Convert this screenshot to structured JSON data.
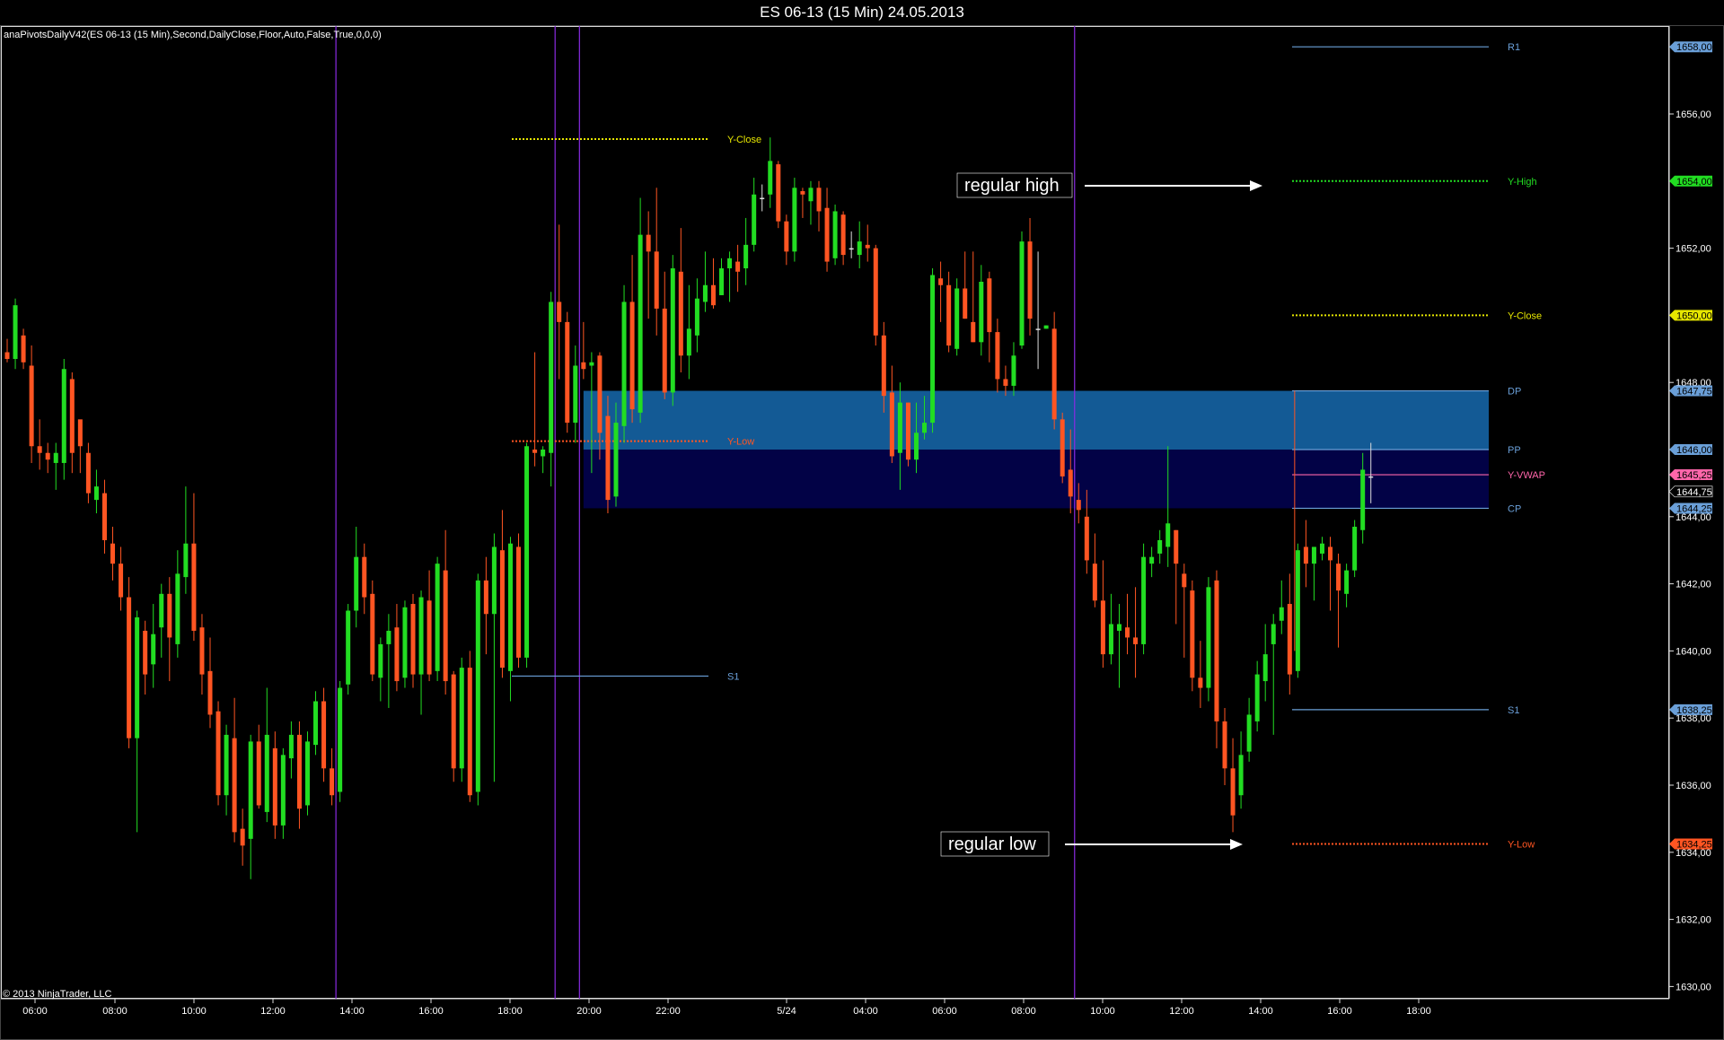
{
  "window": {
    "title": "ES 06-13 (15 Min)  24.05.2013",
    "indicator_label": "anaPivotsDailyV42(ES 06-13 (15 Min),Second,DailyClose,Floor,Auto,False,True,0,0,0)",
    "copyright": "© 2013 NinjaTrader, LLC"
  },
  "colors": {
    "background": "#000000",
    "up_candle": "#22dd22",
    "down_candle": "#ff5522",
    "neutral_candle": "#dddddd",
    "session_divider": "#8a2be2",
    "pivot_blue": "#6a9fd8",
    "y_close": "#e6e600",
    "y_high": "#22dd22",
    "y_low": "#ff5522",
    "y_vwap": "#ff66aa",
    "zone_upper": "#135a95",
    "zone_lower": "#020246"
  },
  "chart_data": {
    "type": "candlestick",
    "instrument": "ES 06-13",
    "interval": "15 Min",
    "ylim": [
      1629.5,
      1659.5
    ],
    "y_ticks": [
      "1656,00",
      "1654,00",
      "1652,00",
      "1650,00",
      "1648,00",
      "1646,00",
      "1644,00",
      "1642,00",
      "1640,00",
      "1638,00",
      "1636,00",
      "1634,00",
      "1632,00",
      "1630,00"
    ],
    "x_ticks": [
      "06:00",
      "08:00",
      "10:00",
      "12:00",
      "14:00",
      "16:00",
      "18:00",
      "20:00",
      "22:00",
      "5/24",
      "04:00",
      "06:00",
      "08:00",
      "10:00",
      "12:00",
      "14:00",
      "16:00",
      "18:00"
    ],
    "price_tags": [
      {
        "text": "1658,00",
        "value": 1658.0,
        "color": "#6a9fd8"
      },
      {
        "text": "1654,00",
        "value": 1654.0,
        "color": "#22dd22"
      },
      {
        "text": "1650,00",
        "value": 1650.0,
        "color": "#e6e600"
      },
      {
        "text": "1647,75",
        "value": 1647.75,
        "color": "#6a9fd8"
      },
      {
        "text": "1646,00",
        "value": 1646.0,
        "color": "#6a9fd8"
      },
      {
        "text": "1645,25",
        "value": 1645.25,
        "color": "#ff66aa"
      },
      {
        "text": "1644,75",
        "value": 1644.75,
        "color": "#000000"
      },
      {
        "text": "1644,25",
        "value": 1644.25,
        "color": "#6a9fd8"
      },
      {
        "text": "1638,25",
        "value": 1638.25,
        "color": "#6a9fd8"
      },
      {
        "text": "1634,25",
        "value": 1634.25,
        "color": "#ff5522"
      }
    ],
    "levels": [
      {
        "name": "Y-Close",
        "value": 1655.25,
        "from": "18:00",
        "to": "23:00",
        "style": "dotted",
        "color": "#e6e600"
      },
      {
        "name": "Y-Low",
        "value": 1646.25,
        "from": "18:00",
        "to": "23:00",
        "style": "dotted",
        "color": "#ff5522"
      },
      {
        "name": "S1",
        "value": 1639.25,
        "from": "18:00",
        "to": "23:00",
        "style": "solid",
        "color": "#6a9fd8"
      },
      {
        "name": "R1",
        "value": 1658.0,
        "from": "14:30",
        "to": "19:00",
        "style": "solid",
        "color": "#6a9fd8"
      },
      {
        "name": "Y-High",
        "value": 1654.0,
        "from": "14:30",
        "to": "19:00",
        "style": "dotted",
        "color": "#22dd22"
      },
      {
        "name": "Y-Close",
        "value": 1650.0,
        "from": "14:30",
        "to": "19:00",
        "style": "dotted",
        "color": "#e6e600"
      },
      {
        "name": "DP",
        "value": 1647.75,
        "from": "14:30",
        "to": "19:00",
        "style": "solid",
        "color": "#6a9fd8"
      },
      {
        "name": "PP",
        "value": 1646.0,
        "from": "14:30",
        "to": "19:00",
        "style": "solid",
        "color": "#6a9fd8"
      },
      {
        "name": "Y-VWAP",
        "value": 1645.25,
        "from": "14:30",
        "to": "19:00",
        "style": "solid",
        "color": "#ff66aa"
      },
      {
        "name": "CP",
        "value": 1644.25,
        "from": "14:30",
        "to": "19:00",
        "style": "solid",
        "color": "#6a9fd8"
      },
      {
        "name": "S1",
        "value": 1638.25,
        "from": "14:30",
        "to": "19:00",
        "style": "solid",
        "color": "#6a9fd8"
      },
      {
        "name": "Y-Low",
        "value": 1634.25,
        "from": "14:30",
        "to": "19:00",
        "style": "dotted",
        "color": "#ff5522"
      }
    ],
    "zones": [
      {
        "top": 1647.75,
        "bottom": 1646.0,
        "color": "#135a95"
      },
      {
        "top": 1646.0,
        "bottom": 1644.25,
        "color": "#020246"
      }
    ],
    "annotations": [
      {
        "text": "regular high",
        "arrow_to_value": 1654.0
      },
      {
        "text": "regular low",
        "arrow_to_value": 1634.25
      }
    ],
    "candles": [
      [
        1648.9,
        1649.3,
        1648.6,
        1648.7
      ],
      [
        1648.7,
        1650.5,
        1648.4,
        1650.3
      ],
      [
        1649.4,
        1649.6,
        1648.4,
        1648.6
      ],
      [
        1648.5,
        1649.1,
        1645.6,
        1646.1
      ],
      [
        1646.1,
        1646.9,
        1645.4,
        1645.9
      ],
      [
        1645.9,
        1646.2,
        1645.3,
        1645.7
      ],
      [
        1645.6,
        1646.2,
        1644.8,
        1645.9
      ],
      [
        1645.6,
        1648.7,
        1645.1,
        1648.4
      ],
      [
        1648.1,
        1648.3,
        1645.3,
        1645.9
      ],
      [
        1646.9,
        1646.4,
        1645.3,
        1646.1
      ],
      [
        1645.9,
        1646.2,
        1644.4,
        1644.7
      ],
      [
        1644.5,
        1645.4,
        1644.1,
        1644.9
      ],
      [
        1644.7,
        1645.1,
        1642.9,
        1643.3
      ],
      [
        1643.2,
        1643.7,
        1642.1,
        1642.6
      ],
      [
        1642.6,
        1643.1,
        1641.2,
        1641.6
      ],
      [
        1641.6,
        1642.2,
        1637.1,
        1637.4
      ],
      [
        1637.4,
        1641.2,
        1634.6,
        1641.0
      ],
      [
        1640.6,
        1640.9,
        1638.7,
        1639.3
      ],
      [
        1639.6,
        1641.4,
        1638.9,
        1640.5
      ],
      [
        1640.7,
        1642.0,
        1639.8,
        1641.7
      ],
      [
        1641.7,
        1642.2,
        1639.1,
        1640.4
      ],
      [
        1640.2,
        1643.0,
        1639.8,
        1642.3
      ],
      [
        1642.2,
        1644.9,
        1641.7,
        1643.2
      ],
      [
        1643.2,
        1644.7,
        1640.3,
        1640.6
      ],
      [
        1640.7,
        1641.1,
        1638.7,
        1639.3
      ],
      [
        1639.4,
        1640.4,
        1637.7,
        1638.1
      ],
      [
        1638.2,
        1638.5,
        1635.4,
        1635.7
      ],
      [
        1635.7,
        1637.8,
        1635.1,
        1637.5
      ],
      [
        1637.4,
        1638.6,
        1634.3,
        1634.6
      ],
      [
        1634.7,
        1635.3,
        1633.6,
        1634.2
      ],
      [
        1634.4,
        1637.5,
        1633.2,
        1637.3
      ],
      [
        1637.3,
        1637.8,
        1635.3,
        1635.4
      ],
      [
        1635.2,
        1638.9,
        1634.9,
        1637.5
      ],
      [
        1637.1,
        1637.6,
        1634.4,
        1634.8
      ],
      [
        1634.8,
        1637.1,
        1634.4,
        1636.9
      ],
      [
        1636.8,
        1637.9,
        1636.2,
        1637.5
      ],
      [
        1637.5,
        1637.9,
        1634.7,
        1635.3
      ],
      [
        1635.4,
        1637.6,
        1635.1,
        1637.3
      ],
      [
        1637.2,
        1638.8,
        1636.9,
        1638.5
      ],
      [
        1638.5,
        1638.9,
        1636.1,
        1636.5
      ],
      [
        1636.5,
        1637.1,
        1635.4,
        1635.7
      ],
      [
        1635.8,
        1639.1,
        1635.5,
        1638.9
      ],
      [
        1639.0,
        1641.4,
        1638.7,
        1641.2
      ],
      [
        1641.2,
        1643.7,
        1640.7,
        1642.8
      ],
      [
        1642.8,
        1643.2,
        1641.1,
        1641.6
      ],
      [
        1641.7,
        1642.1,
        1639.1,
        1639.3
      ],
      [
        1639.2,
        1640.4,
        1638.5,
        1640.2
      ],
      [
        1640.2,
        1641.1,
        1638.3,
        1640.6
      ],
      [
        1640.7,
        1641.4,
        1638.8,
        1639.1
      ],
      [
        1639.2,
        1641.5,
        1638.9,
        1641.3
      ],
      [
        1641.4,
        1641.7,
        1638.9,
        1639.3
      ],
      [
        1639.3,
        1641.8,
        1638.1,
        1641.6
      ],
      [
        1641.5,
        1642.4,
        1639.1,
        1639.3
      ],
      [
        1639.4,
        1642.8,
        1639.1,
        1642.6
      ],
      [
        1642.4,
        1643.6,
        1638.7,
        1639.1
      ],
      [
        1639.3,
        1639.4,
        1636.1,
        1636.5
      ],
      [
        1636.5,
        1639.8,
        1636.1,
        1639.5
      ],
      [
        1639.5,
        1640.0,
        1635.5,
        1635.7
      ],
      [
        1635.8,
        1642.3,
        1635.4,
        1642.1
      ],
      [
        1642.1,
        1642.8,
        1639.9,
        1641.1
      ],
      [
        1641.1,
        1643.5,
        1636.1,
        1643.1
      ],
      [
        1643.0,
        1644.2,
        1639.2,
        1639.5
      ],
      [
        1639.4,
        1643.4,
        1638.5,
        1643.2
      ],
      [
        1643.1,
        1643.5,
        1639.5,
        1639.8
      ],
      [
        1639.8,
        1646.2,
        1639.5,
        1646.1
      ],
      [
        1646.0,
        1648.9,
        1645.5,
        1645.9
      ],
      [
        1645.8,
        1646.1,
        1645.3,
        1646.0
      ],
      [
        1645.9,
        1650.7,
        1644.9,
        1650.4
      ],
      [
        1650.4,
        1652.7,
        1648.1,
        1649.8
      ],
      [
        1649.8,
        1650.1,
        1646.5,
        1646.8
      ],
      [
        1646.8,
        1649.1,
        1646.2,
        1648.5
      ],
      [
        1648.6,
        1649.8,
        1648.1,
        1648.4
      ],
      [
        1648.5,
        1648.9,
        1645.3,
        1648.6
      ],
      [
        1648.8,
        1648.9,
        1645.7,
        1646.5
      ],
      [
        1647.0,
        1647.6,
        1644.1,
        1644.5
      ],
      [
        1644.6,
        1647.4,
        1644.3,
        1646.8
      ],
      [
        1646.7,
        1650.9,
        1646.2,
        1650.4
      ],
      [
        1650.4,
        1651.8,
        1646.8,
        1647.2
      ],
      [
        1647.1,
        1653.5,
        1646.8,
        1652.4
      ],
      [
        1652.4,
        1653.1,
        1649.9,
        1651.9
      ],
      [
        1651.9,
        1653.8,
        1649.4,
        1650.2
      ],
      [
        1650.2,
        1651.3,
        1647.5,
        1647.7
      ],
      [
        1647.7,
        1651.8,
        1647.3,
        1651.4
      ],
      [
        1651.3,
        1652.6,
        1648.3,
        1648.8
      ],
      [
        1648.8,
        1650.9,
        1648.1,
        1649.6
      ],
      [
        1649.4,
        1651.1,
        1648.9,
        1650.5
      ],
      [
        1650.4,
        1651.9,
        1650.1,
        1650.9
      ],
      [
        1650.9,
        1651.7,
        1650.2,
        1650.3
      ],
      [
        1650.6,
        1651.7,
        1650.6,
        1651.4
      ],
      [
        1651.4,
        1651.9,
        1650.4,
        1651.7
      ],
      [
        1651.6,
        1652.1,
        1650.7,
        1651.3
      ],
      [
        1651.4,
        1652.9,
        1650.9,
        1652.1
      ],
      [
        1652.1,
        1654.1,
        1651.9,
        1653.6
      ],
      [
        1653.5,
        1653.9,
        1653.1,
        1653.5
      ],
      [
        1653.6,
        1655.3,
        1653.2,
        1654.6
      ],
      [
        1654.5,
        1654.6,
        1652.6,
        1652.8
      ],
      [
        1652.8,
        1653.0,
        1651.5,
        1651.9
      ],
      [
        1651.9,
        1654.1,
        1651.6,
        1653.8
      ],
      [
        1653.7,
        1653.8,
        1652.9,
        1653.6
      ],
      [
        1653.4,
        1654.0,
        1652.7,
        1653.8
      ],
      [
        1653.8,
        1654.0,
        1652.5,
        1653.1
      ],
      [
        1653.2,
        1653.8,
        1651.3,
        1651.6
      ],
      [
        1651.7,
        1653.3,
        1651.5,
        1653.1
      ],
      [
        1653.0,
        1653.1,
        1651.5,
        1651.8
      ],
      [
        1652.0,
        1652.5,
        1651.7,
        1652.0
      ],
      [
        1651.8,
        1652.8,
        1651.4,
        1652.2
      ],
      [
        1652.1,
        1652.7,
        1651.6,
        1652.0
      ],
      [
        1652.0,
        1652.1,
        1649.1,
        1649.4
      ],
      [
        1649.4,
        1649.8,
        1647.1,
        1647.6
      ],
      [
        1647.7,
        1648.5,
        1645.6,
        1645.8
      ],
      [
        1645.9,
        1648.0,
        1644.8,
        1647.4
      ],
      [
        1647.4,
        1647.4,
        1645.5,
        1645.7
      ],
      [
        1645.7,
        1647.4,
        1645.3,
        1646.5
      ],
      [
        1646.5,
        1647.6,
        1646.3,
        1646.8
      ],
      [
        1646.8,
        1651.4,
        1646.5,
        1651.2
      ],
      [
        1651.1,
        1651.6,
        1649.8,
        1650.9
      ],
      [
        1650.9,
        1651.3,
        1648.9,
        1649.1
      ],
      [
        1649.0,
        1651.1,
        1648.8,
        1650.8
      ],
      [
        1650.8,
        1651.9,
        1649.9,
        1649.9
      ],
      [
        1649.8,
        1651.9,
        1649.2,
        1649.2
      ],
      [
        1649.2,
        1651.5,
        1648.8,
        1651.0
      ],
      [
        1651.1,
        1651.3,
        1648.6,
        1649.5
      ],
      [
        1649.5,
        1649.9,
        1647.7,
        1648.1
      ],
      [
        1648.1,
        1648.5,
        1647.6,
        1647.9
      ],
      [
        1647.9,
        1649.2,
        1647.6,
        1648.8
      ],
      [
        1649.1,
        1652.5,
        1649.0,
        1652.2
      ],
      [
        1652.2,
        1652.9,
        1649.4,
        1649.9
      ],
      [
        1649.6,
        1651.9,
        1648.4,
        1649.6
      ],
      [
        1649.6,
        1649.7,
        1649.6,
        1649.7
      ],
      [
        1649.6,
        1650.1,
        1646.6,
        1646.9
      ],
      [
        1646.9,
        1647.1,
        1645.0,
        1645.2
      ],
      [
        1645.4,
        1646.6,
        1644.1,
        1644.6
      ],
      [
        1644.5,
        1645.0,
        1643.8,
        1644.2
      ],
      [
        1644.0,
        1644.8,
        1642.3,
        1642.7
      ],
      [
        1642.6,
        1643.5,
        1641.3,
        1641.5
      ],
      [
        1641.5,
        1642.7,
        1639.5,
        1639.9
      ],
      [
        1639.9,
        1641.7,
        1639.6,
        1640.8
      ],
      [
        1640.6,
        1641.4,
        1638.9,
        1640.8
      ],
      [
        1640.7,
        1641.7,
        1639.9,
        1640.4
      ],
      [
        1640.4,
        1641.9,
        1639.2,
        1640.2
      ],
      [
        1640.2,
        1643.2,
        1639.9,
        1642.8
      ],
      [
        1642.6,
        1643.1,
        1642.2,
        1642.8
      ],
      [
        1642.9,
        1643.6,
        1642.6,
        1643.3
      ],
      [
        1643.1,
        1646.1,
        1642.5,
        1643.8
      ],
      [
        1643.6,
        1643.6,
        1640.8,
        1642.6
      ],
      [
        1642.3,
        1642.6,
        1639.8,
        1641.9
      ],
      [
        1641.8,
        1642.1,
        1638.8,
        1639.2
      ],
      [
        1639.2,
        1640.3,
        1638.3,
        1638.9
      ],
      [
        1638.9,
        1642.2,
        1638.5,
        1641.9
      ],
      [
        1642.1,
        1642.4,
        1637.1,
        1637.9
      ],
      [
        1637.9,
        1638.3,
        1636.0,
        1636.5
      ],
      [
        1636.5,
        1637.4,
        1634.6,
        1635.1
      ],
      [
        1635.7,
        1637.6,
        1635.3,
        1636.9
      ],
      [
        1637.0,
        1638.6,
        1636.7,
        1638.1
      ],
      [
        1637.9,
        1639.7,
        1637.6,
        1639.3
      ],
      [
        1639.1,
        1640.8,
        1638.5,
        1639.9
      ],
      [
        1640.2,
        1641.1,
        1637.5,
        1640.8
      ],
      [
        1640.9,
        1642.1,
        1640.5,
        1641.3
      ],
      [
        1641.4,
        1642.3,
        1638.7,
        1639.3
      ],
      [
        1639.4,
        1643.2,
        1639.2,
        1643.0
      ],
      [
        1643.1,
        1643.9,
        1641.9,
        1642.6
      ],
      [
        1642.6,
        1643.1,
        1641.5,
        1643.1
      ],
      [
        1642.9,
        1643.4,
        1642.7,
        1643.2
      ],
      [
        1643.1,
        1643.4,
        1641.2,
        1642.7
      ],
      [
        1642.6,
        1642.9,
        1640.1,
        1641.8
      ],
      [
        1641.7,
        1642.6,
        1641.3,
        1642.4
      ],
      [
        1642.4,
        1643.9,
        1642.2,
        1643.7
      ],
      [
        1643.6,
        1645.9,
        1643.2,
        1645.4
      ],
      [
        1645.2,
        1646.2,
        1644.4,
        1645.2
      ]
    ]
  }
}
